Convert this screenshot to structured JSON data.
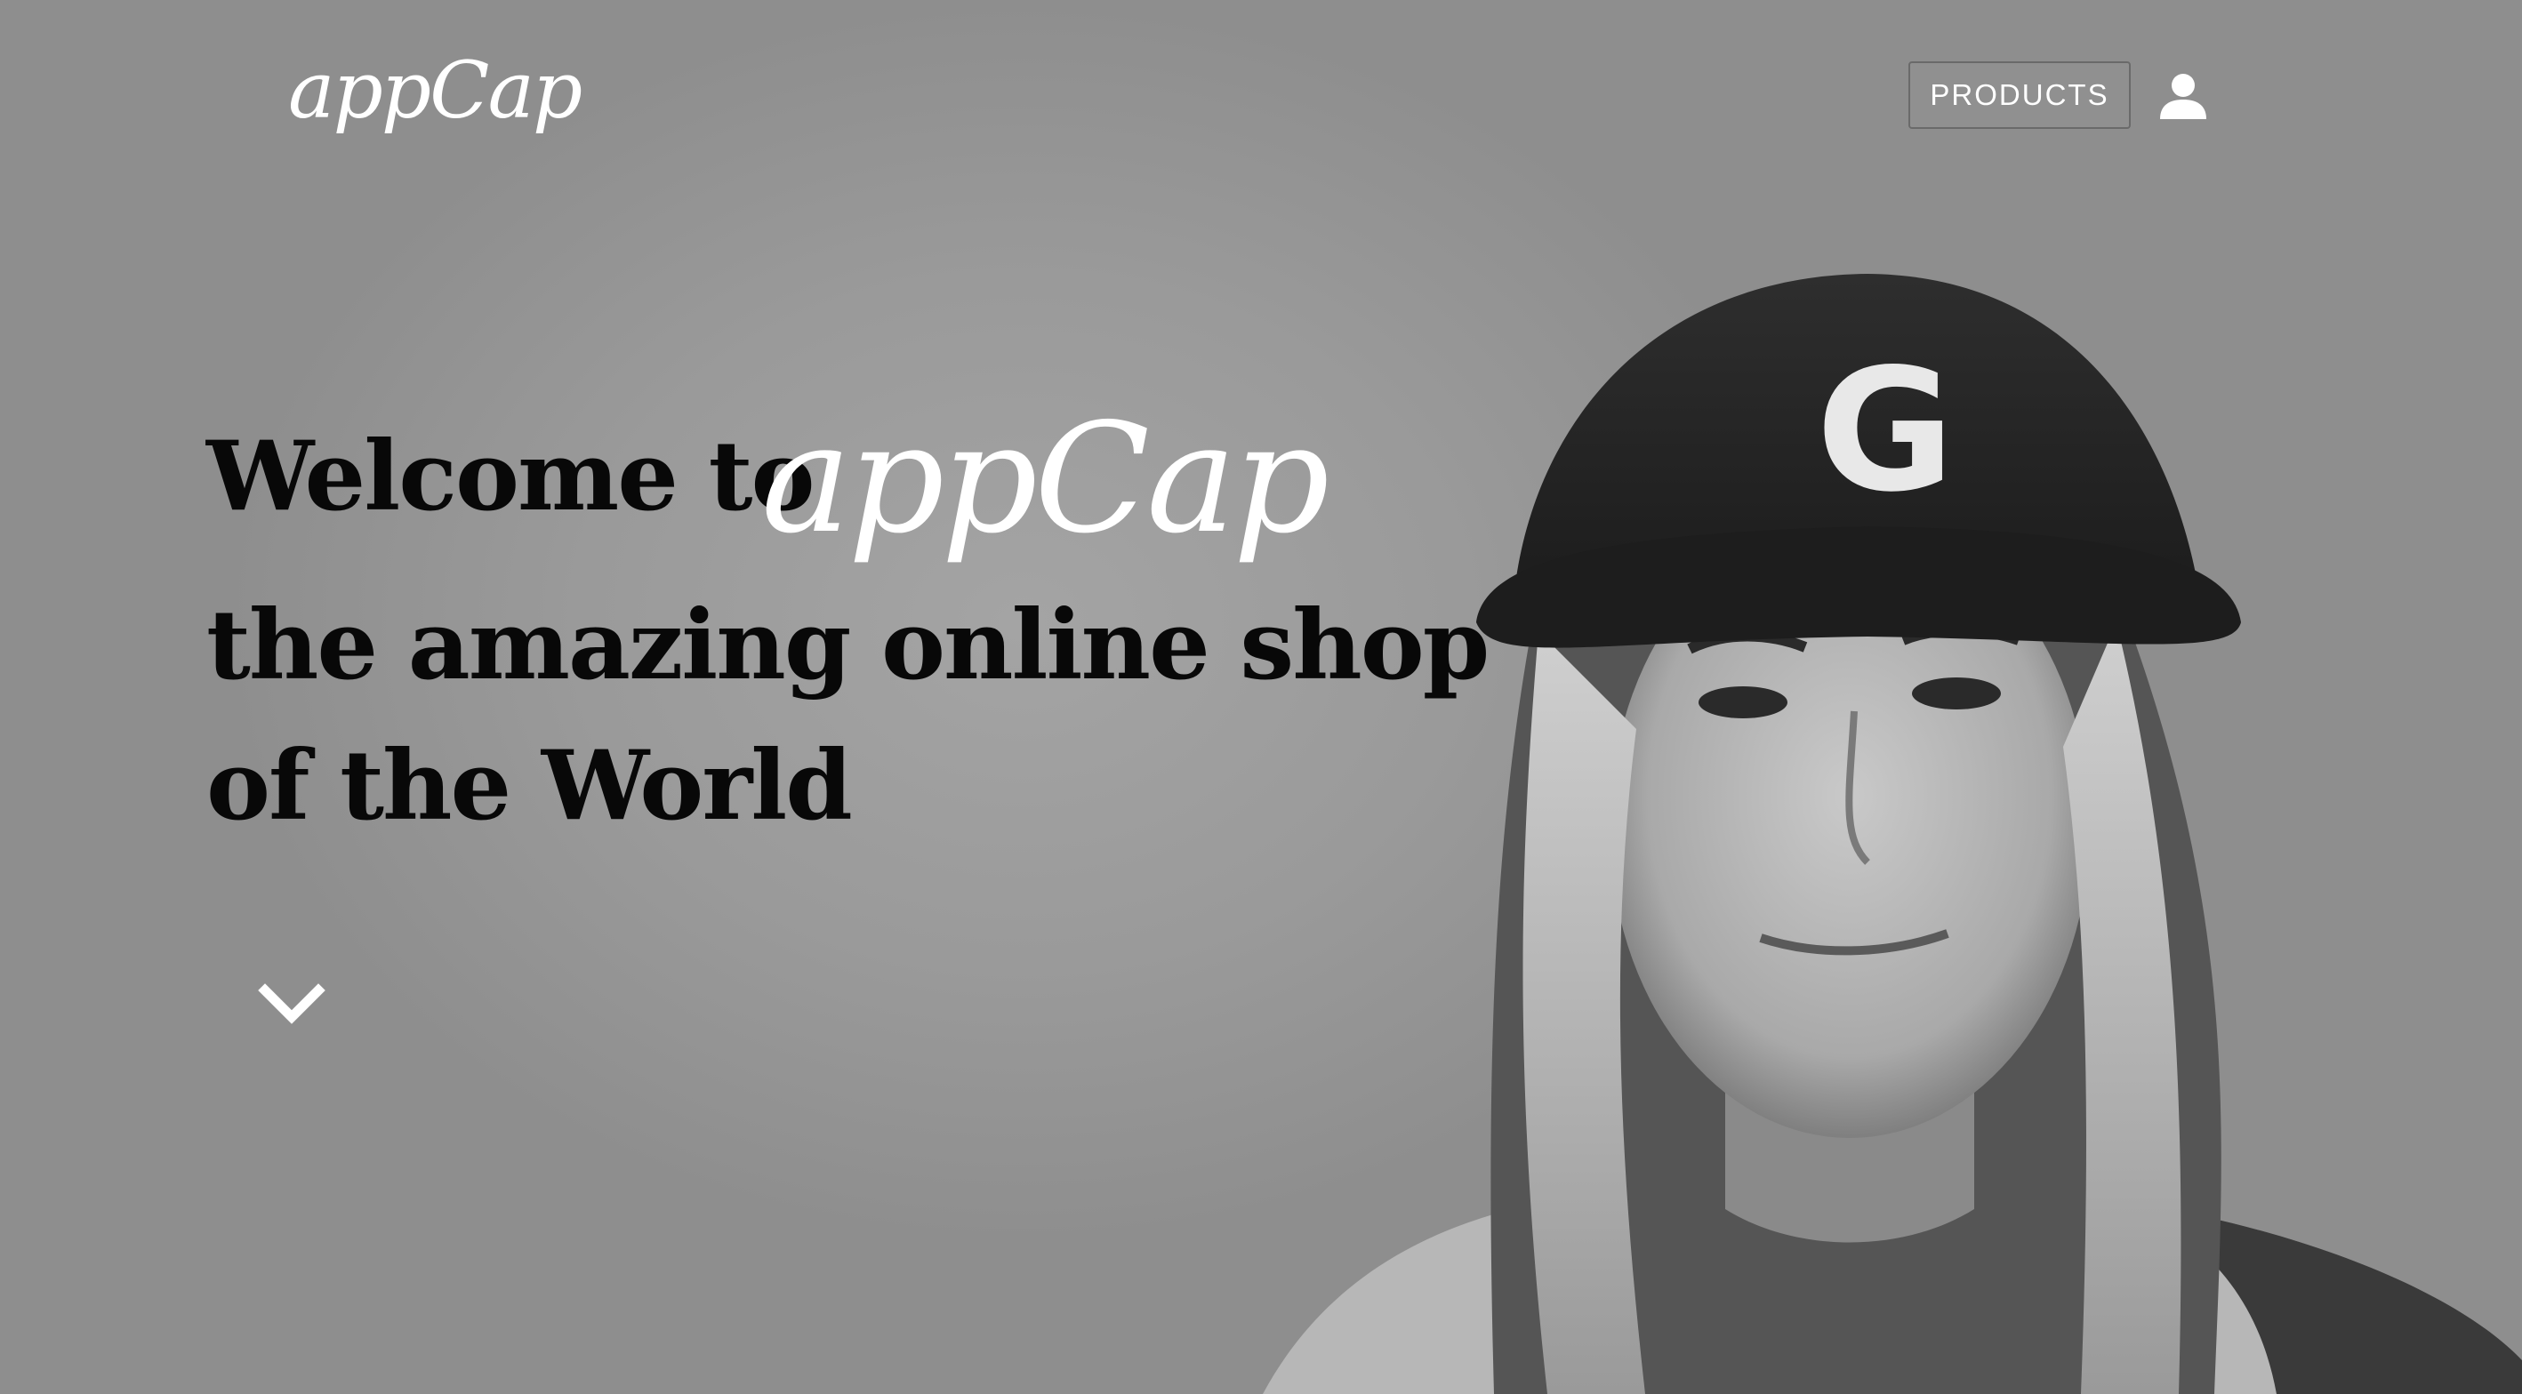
{
  "header": {
    "logo_text": "appCap",
    "products_label": "PRODUCTS",
    "user_icon": "user-icon"
  },
  "hero": {
    "line1": "Welcome to",
    "brand": "appCap",
    "line2": "the amazing online shop",
    "line3": "of the World",
    "scroll_icon": "chevron-down-icon",
    "image_subject": "woman in baseball cap",
    "cap_letter": "G"
  },
  "colors": {
    "background": "#9a9a9a",
    "heading_text": "#080808",
    "accent_text": "#ffffff"
  }
}
